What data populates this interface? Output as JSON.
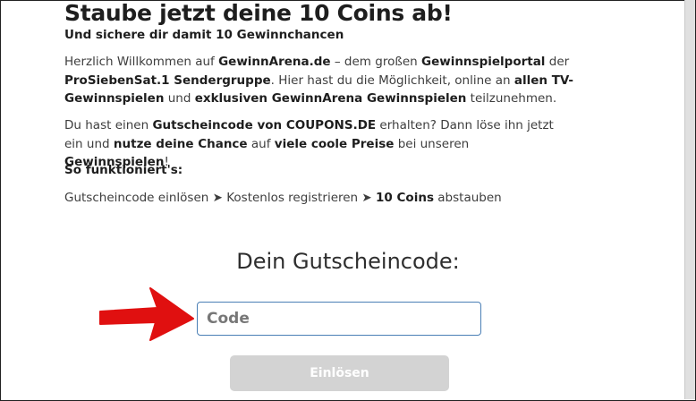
{
  "header": {
    "title": "Staube jetzt deine 10 Coins ab!",
    "subtitle": "Und sichere dir damit 10 Gewinnchancen"
  },
  "intro": {
    "t1": "Herzlich Willkommen auf ",
    "b1": "GewinnArena.de",
    "t2": " – dem großen ",
    "b2": "Gewinnspielportal",
    "t3": " der ",
    "b3": "ProSiebenSat.1 Sendergruppe",
    "t4": ". Hier hast du die Möglichkeit, online an ",
    "b4": "allen TV-Gewinnspielen",
    "t5": " und ",
    "b5": "exklusiven GewinnArena Gewinnspielen",
    "t6": " teilzunehmen."
  },
  "coupon": {
    "t1": "Du hast einen ",
    "b1": "Gutscheincode von COUPONS.DE",
    "t2": " erhalten? Dann löse ihn jetzt ein und ",
    "b2": "nutze deine Chance",
    "t3": " auf ",
    "b3": "viele coole Preise",
    "t4": " bei unseren ",
    "b4": "Gewinnspielen",
    "t5": "!"
  },
  "how": {
    "heading": "So funktioniert's:",
    "step1": "Gutscheincode einlösen",
    "step2": "Kostenlos registrieren",
    "step3_bold": "10 Coins",
    "step3_rest": " abstauben",
    "separator": " ➤ "
  },
  "form": {
    "heading": "Dein Gutscheincode:",
    "input_placeholder": "Code",
    "input_value": "",
    "button_label": "Einlösen"
  },
  "colors": {
    "arrow": "#e01010",
    "input_border": "#4a7fb5",
    "button_bg": "#d3d3d3"
  }
}
